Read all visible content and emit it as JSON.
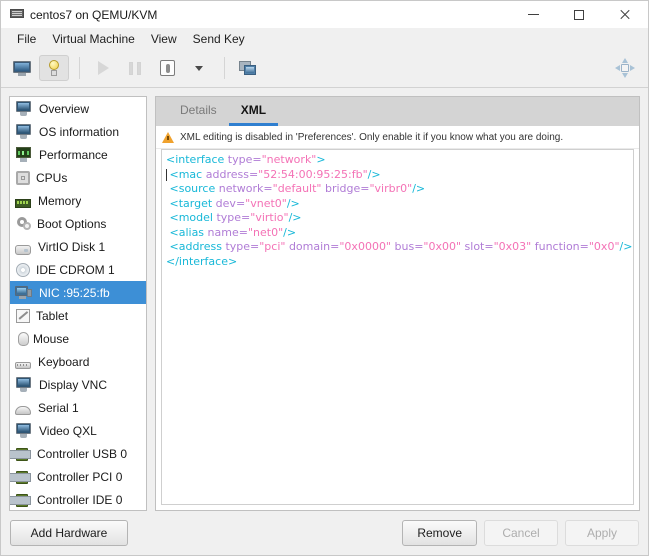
{
  "window": {
    "title": "centos7 on QEMU/KVM",
    "icon": "computer-icon",
    "controls": {
      "minimize": "–",
      "maximize": "□",
      "close": "✕"
    }
  },
  "menubar": {
    "items": [
      {
        "label": "File"
      },
      {
        "label": "Virtual Machine"
      },
      {
        "label": "View"
      },
      {
        "label": "Send Key"
      }
    ]
  },
  "toolbar": {
    "items": [
      {
        "name": "show-console-button",
        "icon": "monitor-icon",
        "state": "normal"
      },
      {
        "name": "show-details-button",
        "icon": "lightbulb-icon",
        "state": "pressed"
      },
      {
        "name": "run-button",
        "icon": "play-icon",
        "state": "disabled"
      },
      {
        "name": "pause-button",
        "icon": "pause-icon",
        "state": "disabled"
      },
      {
        "name": "shutdown-button",
        "icon": "power-icon",
        "state": "normal"
      },
      {
        "name": "shutdown-menu-button",
        "icon": "chevron-down-icon",
        "state": "normal"
      },
      {
        "name": "snapshots-button",
        "icon": "screens-icon",
        "state": "normal"
      }
    ],
    "fullscreen": {
      "name": "fullscreen-button",
      "icon": "expand-arrows-icon"
    }
  },
  "sidebar": {
    "items": [
      {
        "label": "Overview",
        "icon": "computer-icon",
        "variant": "i-pc",
        "selected": false
      },
      {
        "label": "OS information",
        "icon": "computer-icon",
        "variant": "i-pc",
        "selected": false
      },
      {
        "label": "Performance",
        "icon": "performance-icon",
        "variant": "i-perf",
        "selected": false
      },
      {
        "label": "CPUs",
        "icon": "cpu-chip-icon",
        "variant": "i-cpu",
        "selected": false
      },
      {
        "label": "Memory",
        "icon": "memory-icon",
        "variant": "i-mem",
        "selected": false
      },
      {
        "label": "Boot Options",
        "icon": "gears-icon",
        "variant": "i-gear",
        "selected": false
      },
      {
        "label": "VirtIO Disk 1",
        "icon": "disk-icon",
        "variant": "i-disk",
        "selected": false
      },
      {
        "label": "IDE CDROM 1",
        "icon": "cdrom-icon",
        "variant": "i-cd",
        "selected": false
      },
      {
        "label": "NIC :95:25:fb",
        "icon": "network-card-icon",
        "variant": "i-nic",
        "selected": true
      },
      {
        "label": "Tablet",
        "icon": "tablet-icon",
        "variant": "i-tablet",
        "selected": false
      },
      {
        "label": "Mouse",
        "icon": "mouse-icon",
        "variant": "i-mouse",
        "selected": false
      },
      {
        "label": "Keyboard",
        "icon": "keyboard-icon",
        "variant": "i-kb",
        "selected": false
      },
      {
        "label": "Display VNC",
        "icon": "display-icon",
        "variant": "i-pc",
        "selected": false
      },
      {
        "label": "Serial 1",
        "icon": "serial-port-icon",
        "variant": "i-serial",
        "selected": false
      },
      {
        "label": "Video QXL",
        "icon": "video-icon",
        "variant": "i-pc",
        "selected": false
      },
      {
        "label": "Controller USB 0",
        "icon": "controller-icon",
        "variant": "i-ctrl",
        "selected": false
      },
      {
        "label": "Controller PCI 0",
        "icon": "controller-icon",
        "variant": "i-ctrl",
        "selected": false
      },
      {
        "label": "Controller IDE 0",
        "icon": "controller-icon",
        "variant": "i-ctrl",
        "selected": false
      }
    ]
  },
  "panel": {
    "tabs": [
      {
        "label": "Details",
        "active": false
      },
      {
        "label": "XML",
        "active": true
      }
    ],
    "warning": {
      "icon": "warning-triangle-icon",
      "text": "XML editing is disabled in 'Preferences'. Only enable it if you know what you are doing."
    },
    "xml": {
      "lines": [
        {
          "indent": 0,
          "text": "<interface type=\"network\">"
        },
        {
          "indent": 1,
          "text": "<mac address=\"52:54:00:95:25:fb\"/>",
          "cursor": true
        },
        {
          "indent": 1,
          "text": "<source network=\"default\" bridge=\"virbr0\"/>"
        },
        {
          "indent": 1,
          "text": "<target dev=\"vnet0\"/>"
        },
        {
          "indent": 1,
          "text": "<model type=\"virtio\"/>"
        },
        {
          "indent": 1,
          "text": "<alias name=\"net0\"/>"
        },
        {
          "indent": 1,
          "text": "<address type=\"pci\" domain=\"0x0000\" bus=\"0x00\" slot=\"0x03\" function=\"0x0\"/>"
        },
        {
          "indent": 0,
          "text": "</interface>"
        }
      ]
    }
  },
  "footer": {
    "add_hardware": {
      "label": "Add Hardware",
      "disabled": false
    },
    "remove": {
      "label": "Remove",
      "disabled": false
    },
    "cancel": {
      "label": "Cancel",
      "disabled": true
    },
    "apply": {
      "label": "Apply",
      "disabled": true
    }
  },
  "colors": {
    "selection_blue": "#3d8fd6",
    "tab_accent": "#2f7fd0",
    "warning_orange": "#f0a22e",
    "xml_tag": "#18b8d8",
    "xml_attr": "#b07cd6",
    "xml_value": "#f472b6",
    "window_bg": "#f0f0f0"
  }
}
